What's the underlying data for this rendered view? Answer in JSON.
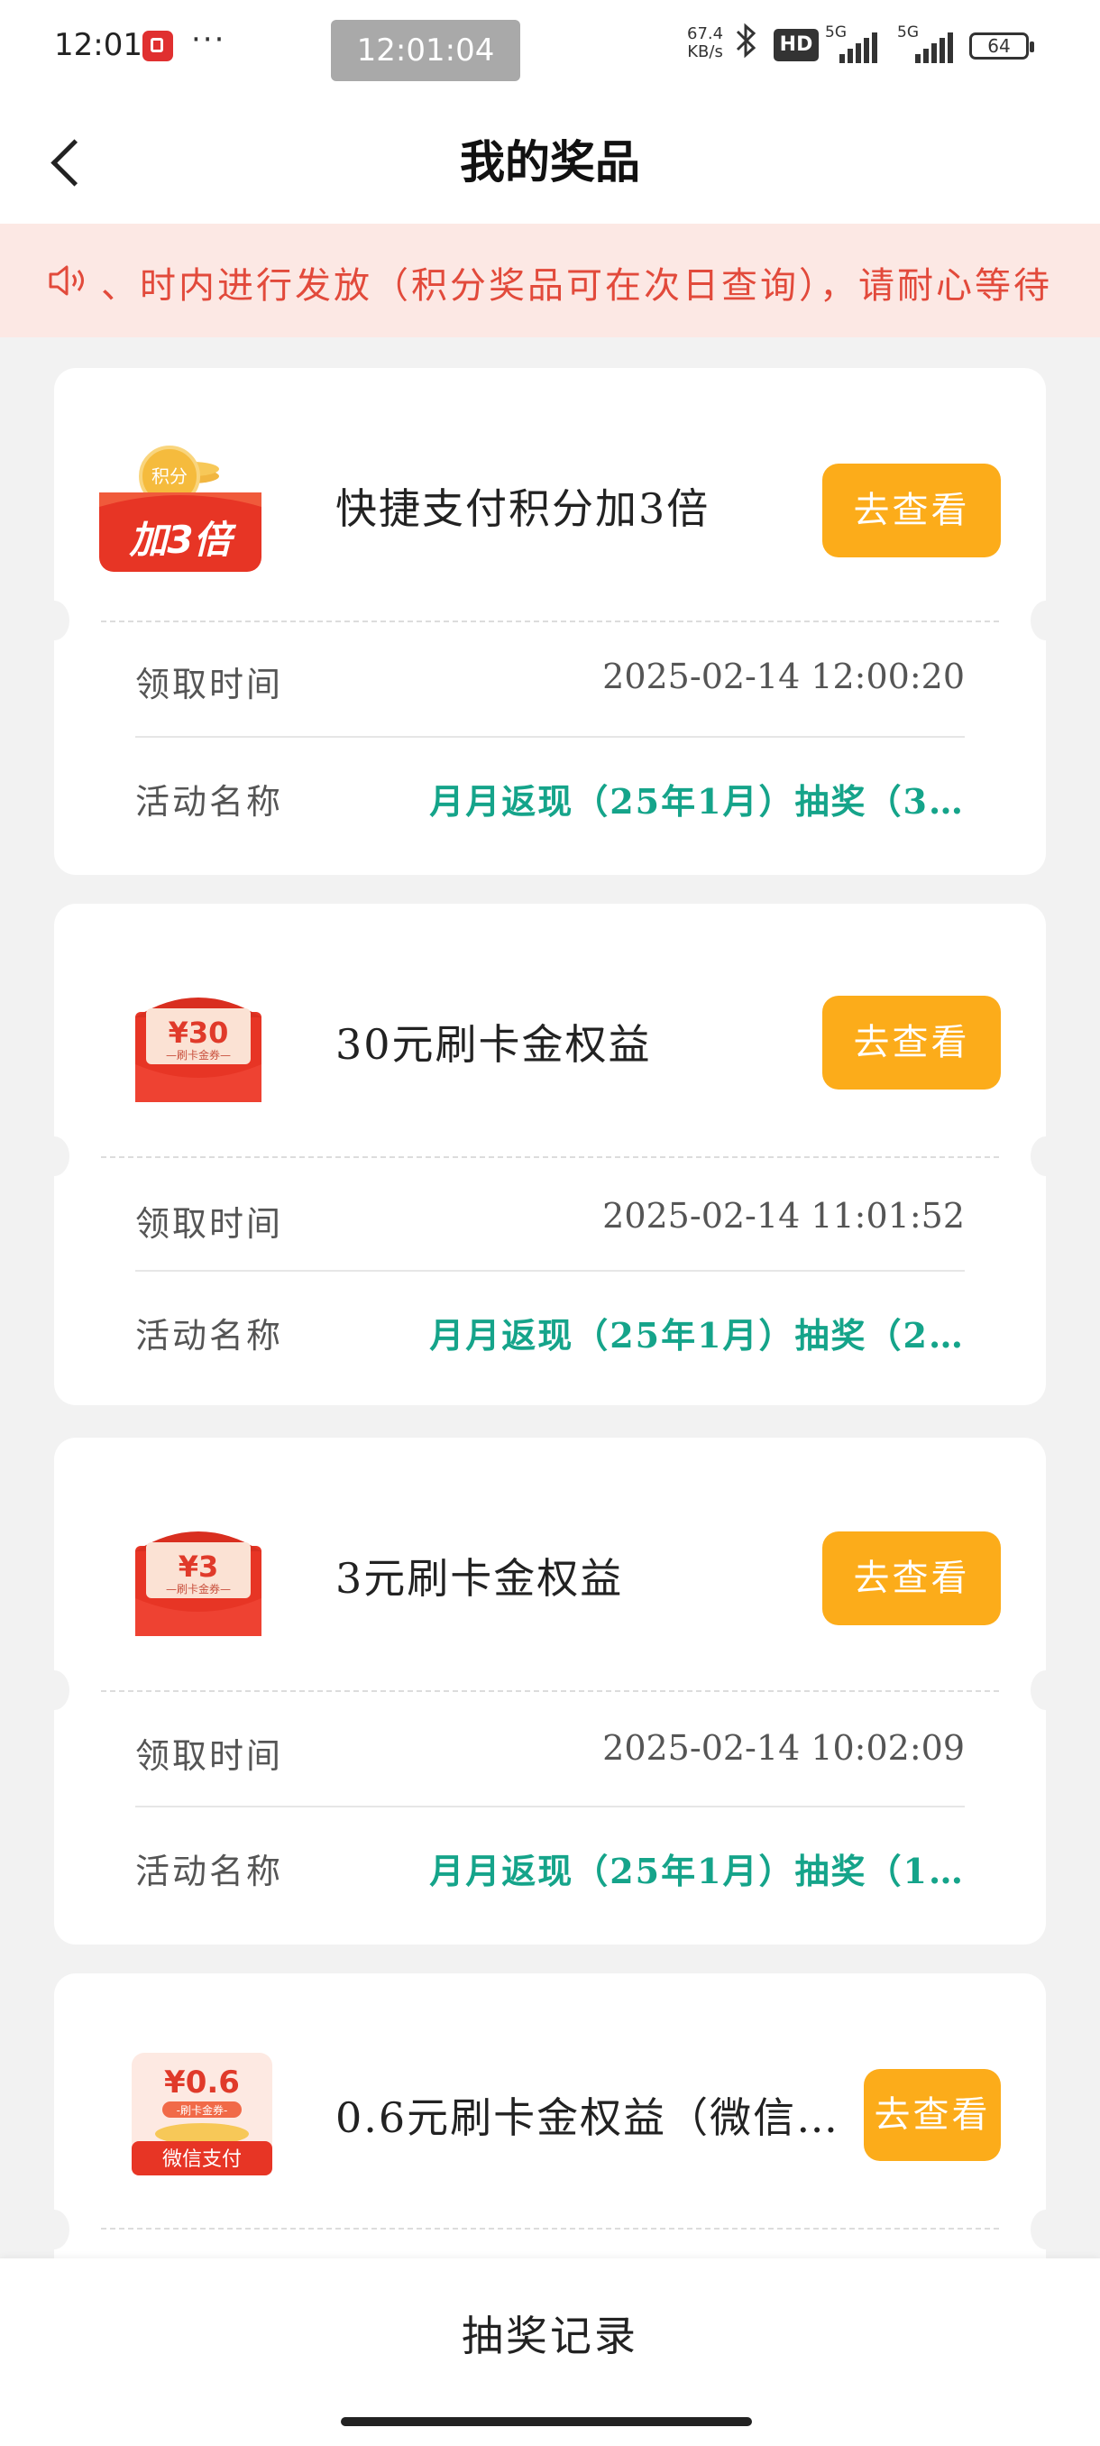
{
  "status_bar": {
    "time": "12:01",
    "more": "···",
    "clock_overlay": "12:01:04",
    "net_speed_value": "67.4",
    "net_speed_unit": "KB/s",
    "hd_badge": "HD",
    "signal1_label": "5G",
    "signal2_label": "5G",
    "battery": "64"
  },
  "header": {
    "title": "我的奖品"
  },
  "notice": {
    "text": "、时内进行发放（积分奖品可在次日查询），请耐心等待"
  },
  "cards": [
    {
      "image_caption": "加3倍",
      "image_badge": "积分",
      "name": "快捷支付积分加3倍",
      "button": "去查看",
      "time_label": "领取时间",
      "time_value": "2025-02-14  12:00:20",
      "activity_label": "活动名称",
      "activity_value": "月月返现（25年1月）抽奖（3…"
    },
    {
      "image_amount": "¥30",
      "image_sub": "—刷卡金券—",
      "name": "30元刷卡金权益",
      "button": "去查看",
      "time_label": "领取时间",
      "time_value": "2025-02-14  11:01:52",
      "activity_label": "活动名称",
      "activity_value": "月月返现（25年1月）抽奖（2…"
    },
    {
      "image_amount": "¥3",
      "image_sub": "—刷卡金券—",
      "name": "3元刷卡金权益",
      "button": "去查看",
      "time_label": "领取时间",
      "time_value": "2025-02-14  10:02:09",
      "activity_label": "活动名称",
      "activity_value": "月月返现（25年1月）抽奖（1…"
    },
    {
      "image_amount": "¥0.6",
      "image_sub": "-刷卡金券-",
      "image_footer": "微信支付",
      "name": "0.6元刷卡金权益（微信…",
      "button": "去查看"
    }
  ],
  "bottom": {
    "label": "抽奖记录"
  },
  "colors": {
    "accent_button": "#fcac1a",
    "notice_bg": "#fce8e4",
    "notice_text": "#e24a3b",
    "activity_text": "#15a48a"
  }
}
